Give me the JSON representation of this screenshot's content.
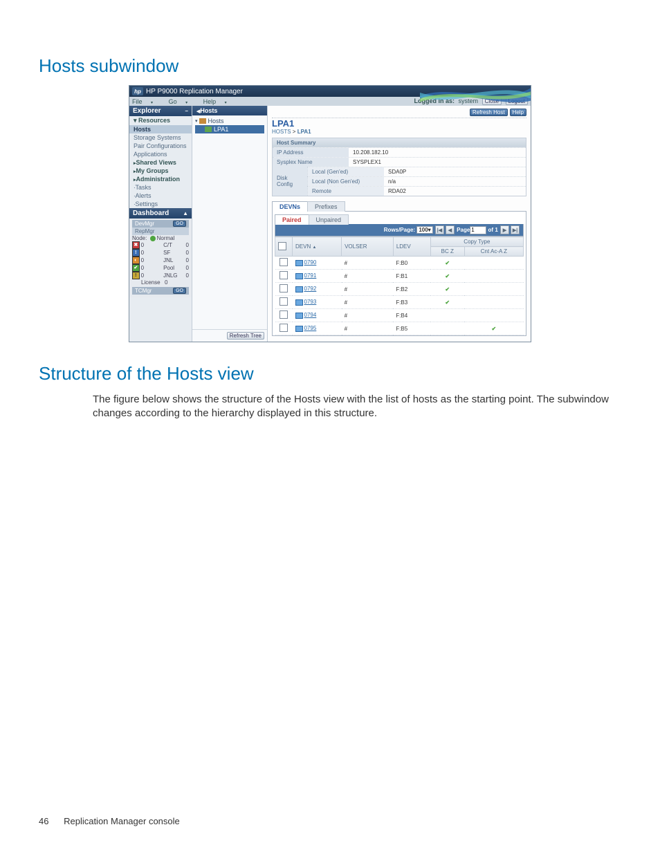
{
  "doc": {
    "section1_title": "Hosts subwindow",
    "section2_title": "Structure of the Hosts view",
    "body_para": "The figure below shows the structure of the Hosts view with the list of hosts as the starting point. The subwindow changes according to the hierarchy displayed in this structure.",
    "page_number": "46",
    "footer_text": "Replication Manager console"
  },
  "app": {
    "title": "HP P9000 Replication Manager",
    "menu": {
      "file": "File",
      "go": "Go",
      "help": "Help"
    },
    "auth": {
      "label": "Logged in as:",
      "user": "system",
      "close": "Close",
      "logout": "Logout"
    },
    "explorer": {
      "title": "Explorer",
      "resources": "Resources",
      "hosts": "Hosts",
      "storage": "Storage Systems",
      "pair": "Pair Configurations",
      "apps": "Applications",
      "shared": "Shared Views",
      "mygroups": "My Groups",
      "admin": "Administration",
      "tasks": "Tasks",
      "alerts": "Alerts",
      "settings": "Settings"
    },
    "dashboard": {
      "title": "Dashboard",
      "devmgr": "DevMgr",
      "repmgr": "RepMgr",
      "go": "GO",
      "node_lbl": "Node:",
      "node_status": "Normal",
      "rows": [
        {
          "v": "0",
          "k": "C/T",
          "n": "0"
        },
        {
          "v": "0",
          "k": "SF",
          "n": "0"
        },
        {
          "v": "0",
          "k": "JNL",
          "n": "0"
        },
        {
          "v": "0",
          "k": "Pool",
          "n": "0"
        },
        {
          "v": "0",
          "k": "JNLG",
          "n": "0"
        }
      ],
      "license": "License",
      "license_v": "0",
      "tcmgr": "TCMgr"
    },
    "tree": {
      "title": "Hosts",
      "root": "Hosts",
      "child": "LPA1",
      "refresh": "Refresh Tree"
    },
    "main": {
      "refresh_host": "Refresh Host",
      "help": "Help",
      "title": "LPA1",
      "crumb_root": "HOSTS",
      "crumb_leaf": "LPA1",
      "hs_title": "Host Summary",
      "ip_l": "IP Address",
      "ip_v": "10.208.182.10",
      "sys_l": "Sysplex Name",
      "sys_v": "SYSPLEX1",
      "disk_l": "Disk Config",
      "dc1_l": "Local (Gen'ed)",
      "dc1_v": "SDA0P",
      "dc2_l": "Local (Non Gen'ed)",
      "dc2_v": "n/a",
      "dc3_l": "Remote",
      "dc3_v": "RDA02",
      "tab_devns": "DEVNs",
      "tab_prefixes": "Prefixes",
      "tab_paired": "Paired",
      "tab_unpaired": "Unpaired",
      "pager": {
        "rows_label": "Rows/Page:",
        "rows_val": "100",
        "page_label": "Page",
        "page_val": "1",
        "of_label": "of",
        "total": "1"
      },
      "headers": {
        "devn": "DEVN",
        "volser": "VOLSER",
        "ldev": "LDEV",
        "copytype": "Copy Type",
        "bcz": "BC Z",
        "cnt": "Cnt Ac-A Z"
      },
      "rows": [
        {
          "devn": "0790",
          "volser": "#",
          "ldev": "F:B0",
          "bcz": true,
          "cnt": false
        },
        {
          "devn": "0791",
          "volser": "#",
          "ldev": "F:B1",
          "bcz": true,
          "cnt": false
        },
        {
          "devn": "0792",
          "volser": "#",
          "ldev": "F:B2",
          "bcz": true,
          "cnt": false
        },
        {
          "devn": "0793",
          "volser": "#",
          "ldev": "F:B3",
          "bcz": true,
          "cnt": false
        },
        {
          "devn": "0794",
          "volser": "#",
          "ldev": "F:B4",
          "bcz": false,
          "cnt": false
        },
        {
          "devn": "0795",
          "volser": "#",
          "ldev": "F:B5",
          "bcz": false,
          "cnt": true
        }
      ]
    }
  }
}
